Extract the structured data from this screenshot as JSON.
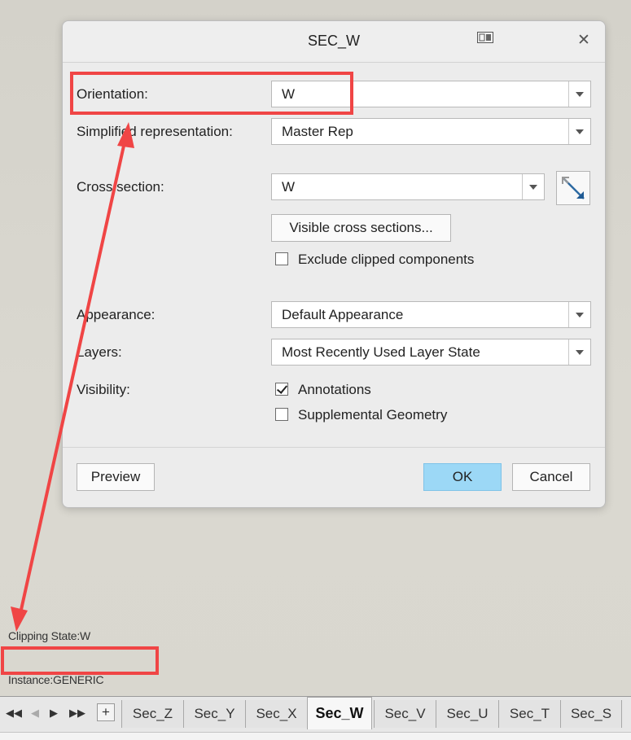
{
  "dialog": {
    "title": "SEC_W",
    "fields": {
      "orientation": {
        "label": "Orientation:",
        "value": "W"
      },
      "simplified_rep": {
        "label": "Simplified representation:",
        "value": "Master Rep"
      },
      "cross_section": {
        "label": "Cross section:",
        "value": "W"
      },
      "appearance": {
        "label": "Appearance:",
        "value": "Default Appearance"
      },
      "layers": {
        "label": "Layers:",
        "value": "Most Recently Used Layer State"
      },
      "visibility": {
        "label": "Visibility:"
      }
    },
    "visible_cross_sections_label": "Visible cross sections...",
    "checkboxes": {
      "exclude_clipped": {
        "label": "Exclude clipped components",
        "checked": false
      },
      "annotations": {
        "label": "Annotations",
        "checked": true
      },
      "supplemental": {
        "label": "Supplemental Geometry",
        "checked": false
      }
    },
    "buttons": {
      "preview": "Preview",
      "ok": "OK",
      "cancel": "Cancel"
    }
  },
  "status": {
    "clipping_state": "Clipping State:W",
    "instance": "Instance:GENERIC"
  },
  "tabs": {
    "items": [
      "Sec_Z",
      "Sec_Y",
      "Sec_X",
      "Sec_W",
      "Sec_V",
      "Sec_U",
      "Sec_T",
      "Sec_S"
    ],
    "active": "Sec_W",
    "add_label": "+"
  },
  "colors": {
    "annotation": "#f04545",
    "ok_button": "#9cd8f6"
  }
}
